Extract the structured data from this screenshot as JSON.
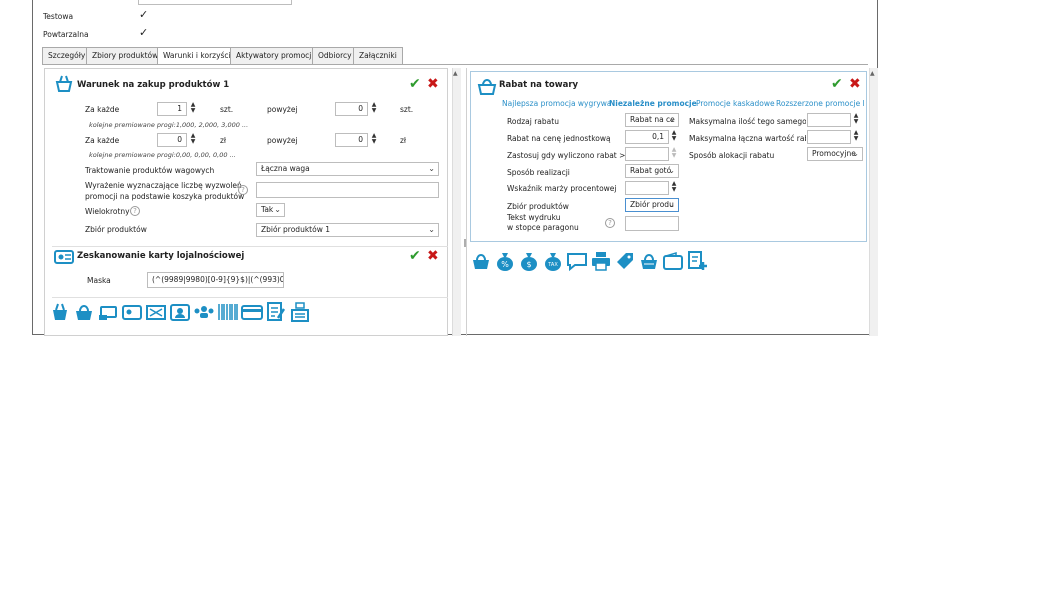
{
  "top_fields": {
    "testowa_label": "Testowa",
    "powtarzalna_label": "Powtarzalna",
    "check_mark": "✓"
  },
  "tabs": [
    "Szczegóły",
    "Zbiory produktów",
    "Warunki i korzyści",
    "Aktywatory promocji",
    "Odbiorcy",
    "Załączniki"
  ],
  "active_tab": "Warunki i korzyści",
  "left_panel": {
    "condition_title": "Warunek na zakup produktów 1",
    "row1": {
      "label": "Za każde",
      "value": "1",
      "unit": "szt.",
      "above_label": "powyżej",
      "above_value": "0",
      "above_unit": "szt."
    },
    "row1_hint": "kolejne premiowane progi:1,000, 2,000, 3,000 ...",
    "row2": {
      "label": "Za każde",
      "value": "0",
      "unit": "zł",
      "above_label": "powyżej",
      "above_value": "0",
      "above_unit": "zł"
    },
    "row2_hint": "kolejne premiowane progi:0,00, 0,00, 0,00 ...",
    "weight_label": "Traktowanie produktów wagowych",
    "weight_value": "Łączna waga",
    "expression_label_1": "Wyrażenie wyznaczające liczbę wyzwoleń",
    "expression_label_2": "promocji na podstawie koszyka produktów",
    "expression_value": "",
    "multiple_label": "Wielokrotny",
    "multiple_value": "Tak",
    "productset_label": "Zbiór produktów",
    "productset_value": "Zbiór produktów 1",
    "loyalty_title": "Zeskanowanie karty lojalnościowej",
    "mask_label": "Maska",
    "mask_value": "(^(9989|9980)[0-9]{9}$)|(^(993)0"
  },
  "right_panel": {
    "title": "Rabat na towary",
    "promo_tabs": [
      "Najlepsza promocja wygrywa",
      "Niezależne promocje",
      "Promocje kaskadowe",
      "Rozszerzone promocje ka"
    ],
    "active_promo_tab": "Niezależne promocje",
    "discount_type_label": "Rodzaj rabatu",
    "discount_type_value": "Rabat na ce",
    "unit_price_label": "Rabat na cenę jednostkową",
    "unit_price_value": "0,1",
    "apply_when_label": "Zastosuj gdy wyliczono rabat >=",
    "apply_when_value": "",
    "realization_label": "Sposób realizacji",
    "realization_value": "Rabat gotó",
    "margin_label": "Wskaźnik marży procentowej",
    "margin_value": "",
    "productset_label": "Zbiór produktów",
    "productset_value": "Zbiór produ",
    "print_label_1": "Tekst wydruku",
    "print_label_2": "w stopce paragonu",
    "print_value": "",
    "max_qty_label": "Maksymalna ilość tego samego to",
    "max_qty_value": "",
    "max_total_label": "Maksymalna łączna wartość rabat",
    "max_total_value": "",
    "allocation_label": "Sposób alokacji rabatu",
    "allocation_value": "Promocyjne"
  },
  "left_toolbar_icons": [
    "hand-basket-icon",
    "basket-icon",
    "card-hand-icon",
    "loyalty-card-icon",
    "voucher-icon",
    "id-card-icon",
    "group-icon",
    "barcode-icon",
    "credit-card-icon",
    "form-edit-icon",
    "cash-register-icon"
  ],
  "right_toolbar_icons": [
    "basket-discount-icon",
    "bag-percent-icon",
    "bag-dollar-icon",
    "bag-tax-icon",
    "speech-icon",
    "printer-icon",
    "tag-icon",
    "basket-gift-icon",
    "wallet-icon",
    "add-document-icon"
  ],
  "colors": {
    "accent": "#2a8fc8",
    "icon": "#1d8fc4",
    "ok": "#2e9b2e",
    "cancel": "#c81818",
    "panel_border": "#a9c9e0"
  }
}
